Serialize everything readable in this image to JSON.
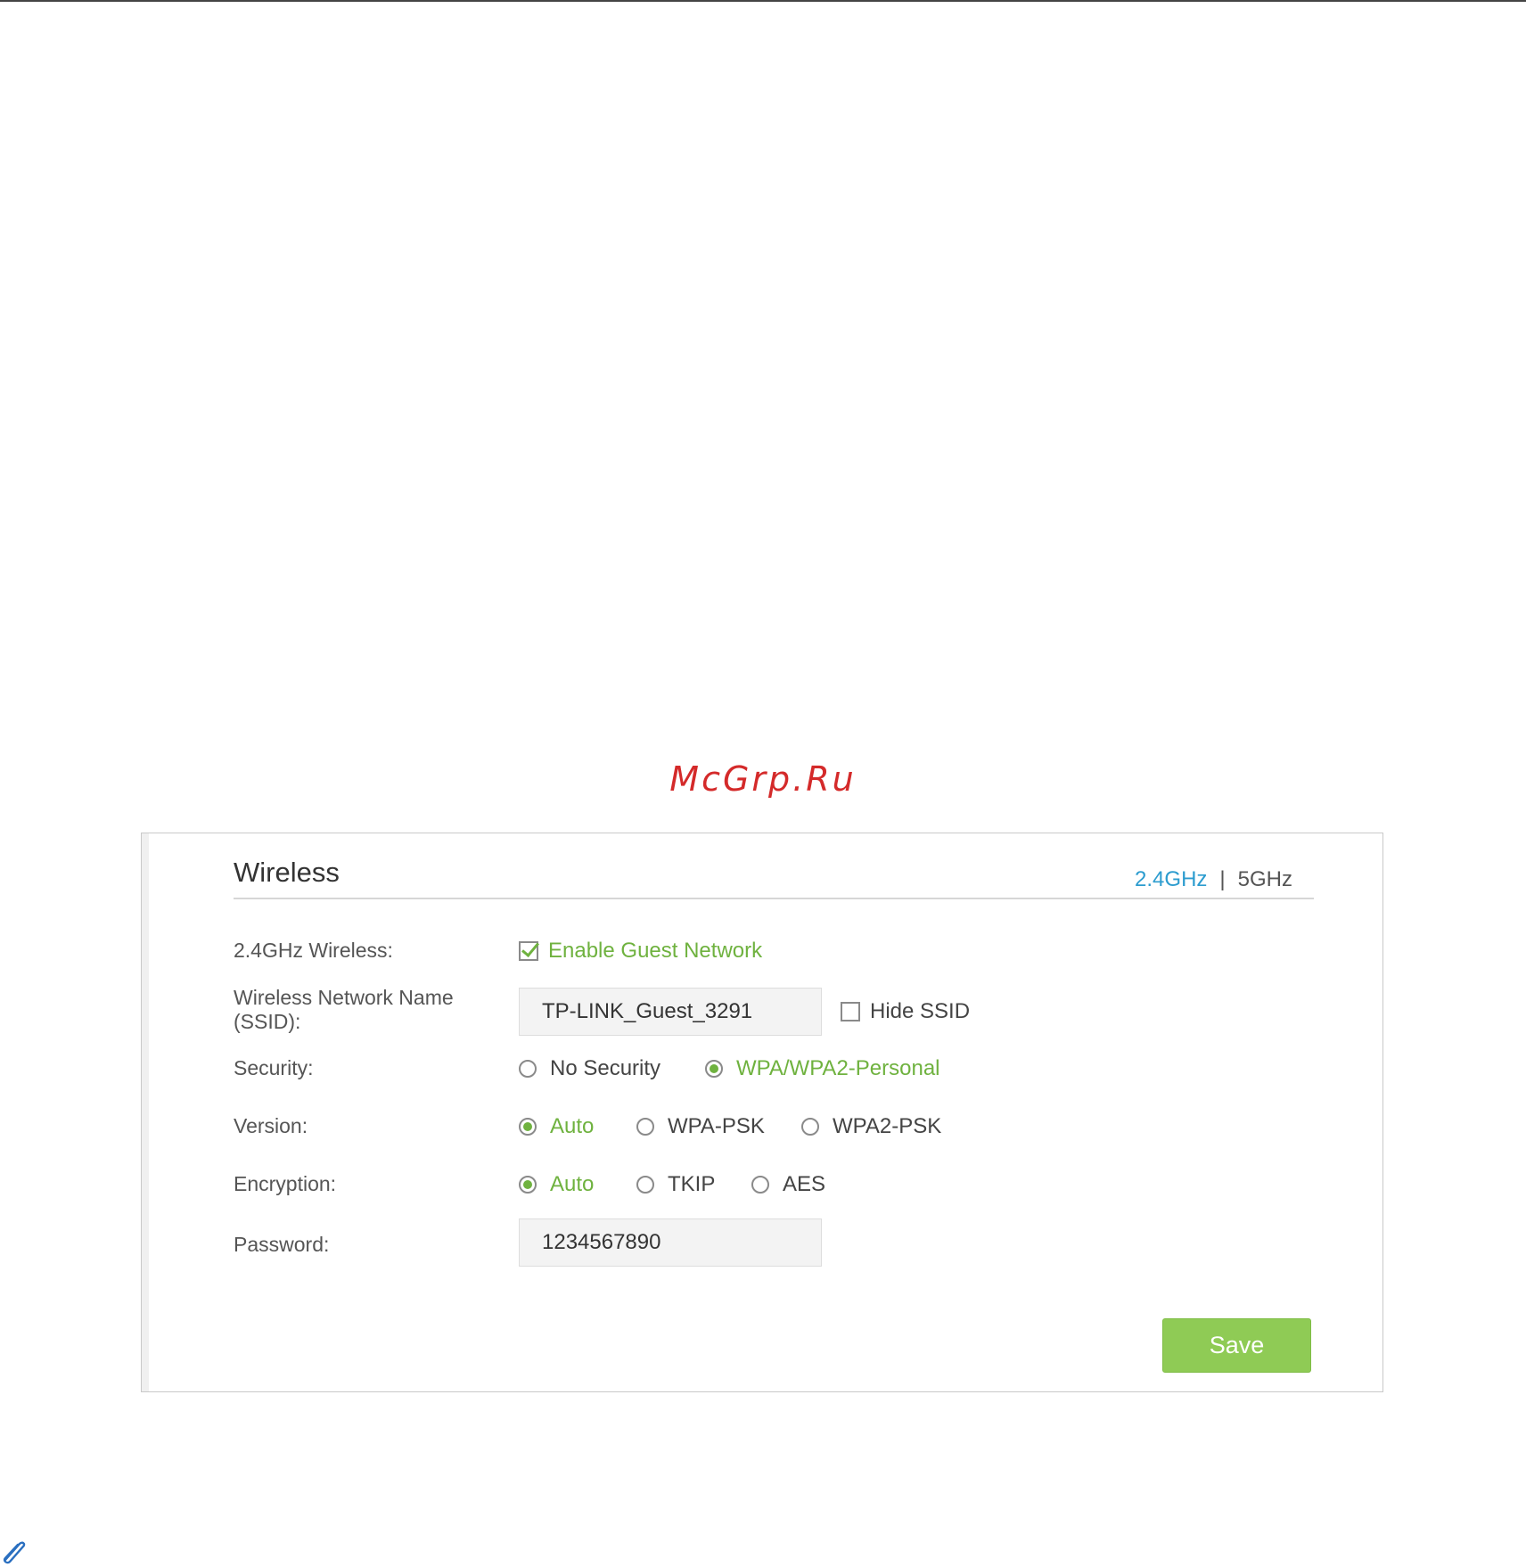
{
  "watermark": "McGrp.Ru",
  "panel": {
    "title": "Wireless",
    "band_active": "2.4GHz",
    "band_separator": "|",
    "band_other": "5GHz"
  },
  "form": {
    "wireless_label": "2.4GHz Wireless:",
    "enable_guest_label": "Enable Guest Network",
    "enable_guest_checked": true,
    "ssid_label_line1": "Wireless Network Name",
    "ssid_label_line2": "(SSID):",
    "ssid_value": "TP-LINK_Guest_3291",
    "hide_ssid_label": "Hide SSID",
    "hide_ssid_checked": false,
    "security_label": "Security:",
    "security_options": [
      "No Security",
      "WPA/WPA2-Personal"
    ],
    "security_selected": "WPA/WPA2-Personal",
    "version_label": "Version:",
    "version_options": [
      "Auto",
      "WPA-PSK",
      "WPA2-PSK"
    ],
    "version_selected": "Auto",
    "encryption_label": "Encryption:",
    "encryption_options": [
      "Auto",
      "TKIP",
      "AES"
    ],
    "encryption_selected": "Auto",
    "password_label": "Password:",
    "password_value": "1234567890",
    "save_label": "Save"
  },
  "colors": {
    "accent_green": "#6fb23f",
    "button_green": "#8fcb55",
    "band_active_blue": "#2c9ccf",
    "watermark_red": "#d42a2a"
  },
  "icons": {
    "bottom_left": "paperclip-icon"
  }
}
